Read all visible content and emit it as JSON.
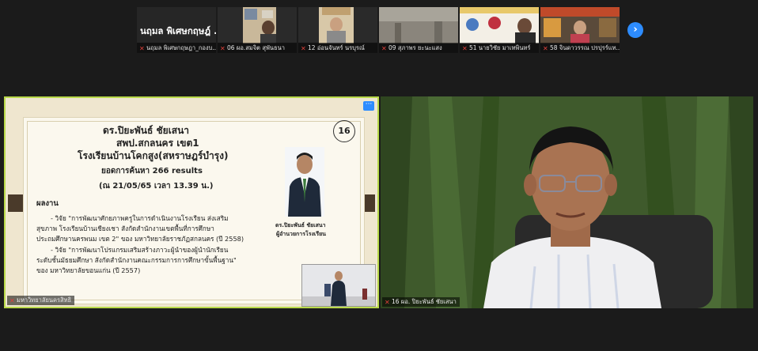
{
  "participants": [
    {
      "display_name": "นฤมล  พิเศษกฤษฎ์ ...",
      "label": "นฤมล  พิเศษกฤษฎา_กองบ..."
    },
    {
      "display_name": "",
      "label": "06 ผอ.สมจิต สุพันธนา"
    },
    {
      "display_name": "",
      "label": "12 อ่อนจันทร์  นรบุรณ์"
    },
    {
      "display_name": "",
      "label": "09 สุภาพร ยะนะแสง"
    },
    {
      "display_name": "",
      "label": "51 นายวิชัย มาเทพินทร์"
    },
    {
      "display_name": "",
      "label": "58 จินดาวรรณ ปรปุรร์แท..."
    }
  ],
  "next_button": "›",
  "share": {
    "more_label": "···",
    "presenter_label": "มหาวิทยาลัยนครสิทธิ",
    "slide": {
      "name": "ดร.ปิยะพันธ์  ชัยเสนา",
      "office": "สพป.สกลนคร เขต1",
      "school": "โรงเรียนบ้านโคกสูง(สหราษฎร์บำรุง)",
      "page_number": "16",
      "search_count": "ยอดการค้นหา 266 results",
      "search_date": "(ณ 21/05/65  เวลา 13.39 น.)",
      "section": "ผลงาน",
      "line1": "- วิจัย \"การพัฒนาศักยภาพครูในการดำเนินงานโรงเรียน ส่งเสริม",
      "line2": "สุขภาพ โรงเรียนบ้านเชียงเชา สังกัดสำนักงานเขตพื้นที่การศึกษา",
      "line3": "ประถมศึกษานครพนม เขต 2\" ของ มหาวิทยาลัยราชภัฏสกลนคร (ปี 2558)",
      "line4": "- วิจัย \"การพัฒนาโปรแกรมเสริมสร้างภาวะผู้นำของผู้นำนักเรียน",
      "line5": "ระดับชั้นมัธยมศึกษา สังกัดสำนักงานคณะกรรมการการศึกษาขั้นพื้นฐาน\"",
      "line6": "ของ มหาวิทยาลัยขอนแก่น (ปี 2557)",
      "caption_name": "ดร.ปิยะพันธ์ ชัยเสนา",
      "caption_role": "ผู้อำนวยการโรงเรียน"
    }
  },
  "speaker": {
    "label": "16 ผอ. ปิยะพันธ์  ชัยเสนา"
  },
  "colors": {
    "active_border": "#b9d94a",
    "accent": "#2d8cff",
    "muted_mic": "#e0403a"
  }
}
